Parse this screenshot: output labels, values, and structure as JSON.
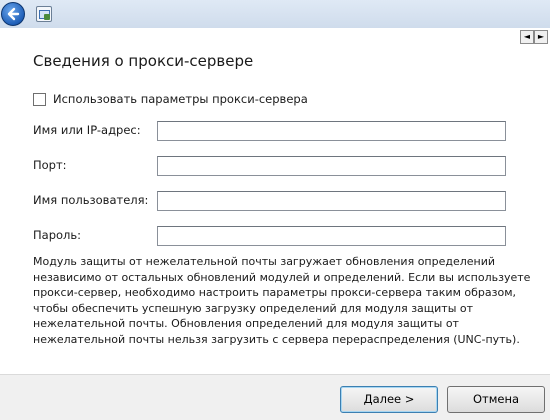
{
  "titlebar": {
    "back_icon": "back-arrow-icon",
    "app_icon": "window-app-icon"
  },
  "page": {
    "title": "Сведения о прокси-сервере"
  },
  "proxy_checkbox": {
    "label": "Использовать параметры прокси-сервера",
    "checked": false
  },
  "fields": {
    "host": {
      "label": "Имя или IP-адрес:",
      "value": ""
    },
    "port": {
      "label": "Порт:",
      "value": ""
    },
    "username": {
      "label": "Имя пользователя:",
      "value": ""
    },
    "password": {
      "label": "Пароль:",
      "value": ""
    }
  },
  "info": {
    "text": "Модуль защиты от нежелательной почты загружает обновления определений независимо от остальных обновлений модулей и определений. Если вы используете прокси-сервер, необходимо настроить параметры прокси-сервера таким образом, чтобы обеспечить успешную загрузку определений для модуля защиты от нежелательной почты. Обновления определений для модуля защиты от нежелательной почты нельзя загрузить с сервера перераспределения (UNC-путь)."
  },
  "buttons": {
    "next": "Далее >",
    "cancel": "Отмена"
  },
  "scroll": {
    "left_glyph": "◄",
    "right_glyph": "►"
  },
  "colors": {
    "titlebar": "#d7e3f1",
    "footer": "#f0f0f0",
    "back_button": "#1f5fb8"
  }
}
